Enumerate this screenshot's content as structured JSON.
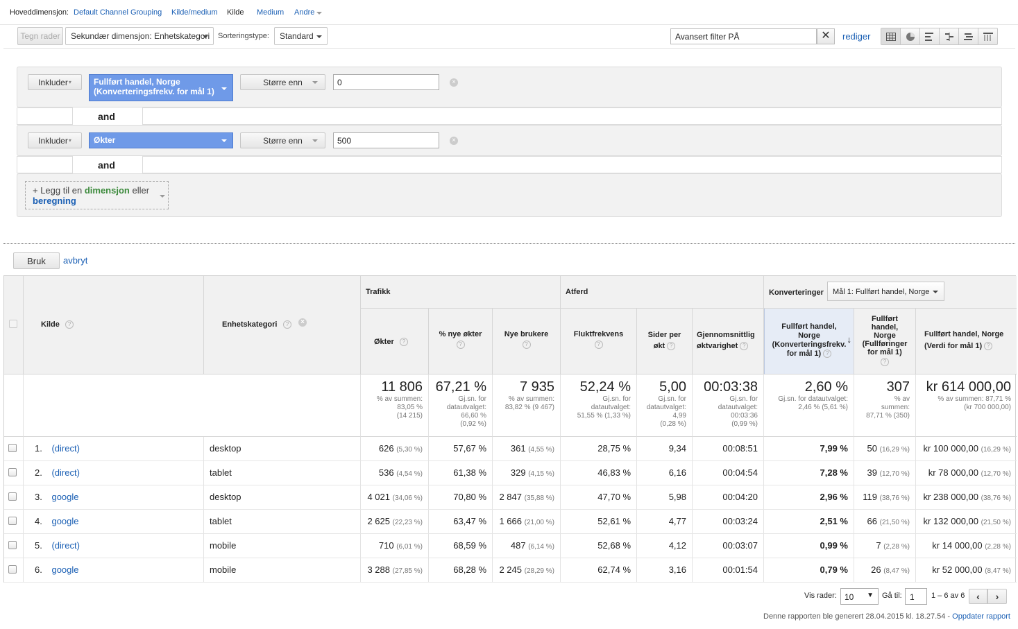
{
  "dimension_bar": {
    "label": "Hoveddimensjon:",
    "options": [
      "Default Channel Grouping",
      "Kilde/medium",
      "Kilde",
      "Medium",
      "Andre"
    ]
  },
  "toolbar": {
    "plot_rows": "Tegn rader",
    "secondary_dimension": "Sekundær dimensjon: Enhetskategori",
    "sort_label": "Sorteringstype:",
    "sort_value": "Standard",
    "filter_value": "Avansert filter PÅ",
    "edit_link": "rediger"
  },
  "filter": {
    "conditions": [
      {
        "mode": "Inkluder",
        "field_line1": "Fullført handel, Norge",
        "field_line2": "(Konverteringsfrekv. for mål 1)",
        "operator": "Større enn",
        "value": "0"
      },
      {
        "mode": "Inkluder",
        "field_line1": "Økter",
        "field_line2": "",
        "operator": "Større enn",
        "value": "500"
      }
    ],
    "and_label": "and",
    "add_prefix": "+ Legg til en",
    "add_dimension": "dimensjon",
    "add_or": "eller",
    "add_metric": "beregning",
    "apply": "Bruk",
    "cancel": "avbryt"
  },
  "table": {
    "group_headers": {
      "traffic": "Trafikk",
      "behavior": "Atferd",
      "conversions": "Konverteringer",
      "goal_select": "Mål 1: Fullført handel, Norge"
    },
    "col_source": "Kilde",
    "col_device": "Enhetskategori",
    "columns": {
      "sessions": "Økter",
      "new_sessions": "% nye økter",
      "new_users": "Nye brukere",
      "bounce": "Fluktfrekvens",
      "pages": [
        "Sider per",
        "økt"
      ],
      "duration": [
        "Gjennomsnittlig",
        "øktvarighet"
      ],
      "conv_rate": [
        "Fullført handel,",
        "Norge",
        "(Konverteringsfrekv.",
        "for mål 1)"
      ],
      "completions": [
        "Fullført",
        "handel,",
        "Norge",
        "(Fullføringer",
        "for mål 1)"
      ],
      "value": [
        "Fullført handel, Norge",
        "(Verdi for mål 1)"
      ]
    },
    "totals": {
      "sessions": {
        "big": "11 806",
        "sub": [
          "% av summen:",
          "83,05 %",
          "(14 215)"
        ]
      },
      "new_sessions": {
        "big": "67,21 %",
        "sub": [
          "Gj.sn. for",
          "datautvalget:",
          "66,60 %",
          "(0,92 %)"
        ]
      },
      "new_users": {
        "big": "7 935",
        "sub": [
          "% av summen:",
          "83,82 % (9 467)"
        ]
      },
      "bounce": {
        "big": "52,24 %",
        "sub": [
          "Gj.sn. for",
          "datautvalget:",
          "51,55 % (1,33 %)"
        ]
      },
      "pages": {
        "big": "5,00",
        "sub": [
          "Gj.sn. for",
          "datautvalget:",
          "4,99",
          "(0,28 %)"
        ]
      },
      "duration": {
        "big": "00:03:38",
        "sub": [
          "Gj.sn. for",
          "datautvalget:",
          "00:03:36",
          "(0,99 %)"
        ]
      },
      "conv_rate": {
        "big": "2,60 %",
        "sub": [
          "Gj.sn. for datautvalget:",
          "2,46 % (5,61 %)"
        ]
      },
      "completions": {
        "big": "307",
        "sub": [
          "% av",
          "summen:",
          "87,71 % (350)"
        ]
      },
      "value": {
        "big": "kr 614 000,00",
        "sub": [
          "% av summen: 87,71 %",
          "(kr 700 000,00)"
        ]
      }
    },
    "rows": [
      {
        "idx": "1.",
        "source": "(direct)",
        "device": "desktop",
        "sessions": "626",
        "sessions_pct": "(5,30 %)",
        "new_sessions": "57,67 %",
        "new_users": "361",
        "new_users_pct": "(4,55 %)",
        "bounce": "28,75 %",
        "pages": "9,34",
        "duration": "00:08:51",
        "conv_rate": "7,99 %",
        "completions": "50",
        "completions_pct": "(16,29 %)",
        "value": "kr 100 000,00",
        "value_pct": "(16,29 %)"
      },
      {
        "idx": "2.",
        "source": "(direct)",
        "device": "tablet",
        "sessions": "536",
        "sessions_pct": "(4,54 %)",
        "new_sessions": "61,38 %",
        "new_users": "329",
        "new_users_pct": "(4,15 %)",
        "bounce": "46,83 %",
        "pages": "6,16",
        "duration": "00:04:54",
        "conv_rate": "7,28 %",
        "completions": "39",
        "completions_pct": "(12,70 %)",
        "value": "kr 78 000,00",
        "value_pct": "(12,70 %)"
      },
      {
        "idx": "3.",
        "source": "google",
        "device": "desktop",
        "sessions": "4 021",
        "sessions_pct": "(34,06 %)",
        "new_sessions": "70,80 %",
        "new_users": "2 847",
        "new_users_pct": "(35,88 %)",
        "bounce": "47,70 %",
        "pages": "5,98",
        "duration": "00:04:20",
        "conv_rate": "2,96 %",
        "completions": "119",
        "completions_pct": "(38,76 %)",
        "value": "kr 238 000,00",
        "value_pct": "(38,76 %)"
      },
      {
        "idx": "4.",
        "source": "google",
        "device": "tablet",
        "sessions": "2 625",
        "sessions_pct": "(22,23 %)",
        "new_sessions": "63,47 %",
        "new_users": "1 666",
        "new_users_pct": "(21,00 %)",
        "bounce": "52,61 %",
        "pages": "4,77",
        "duration": "00:03:24",
        "conv_rate": "2,51 %",
        "completions": "66",
        "completions_pct": "(21,50 %)",
        "value": "kr 132 000,00",
        "value_pct": "(21,50 %)"
      },
      {
        "idx": "5.",
        "source": "(direct)",
        "device": "mobile",
        "sessions": "710",
        "sessions_pct": "(6,01 %)",
        "new_sessions": "68,59 %",
        "new_users": "487",
        "new_users_pct": "(6,14 %)",
        "bounce": "52,68 %",
        "pages": "4,12",
        "duration": "00:03:07",
        "conv_rate": "0,99 %",
        "completions": "7",
        "completions_pct": "(2,28 %)",
        "value": "kr 14 000,00",
        "value_pct": "(2,28 %)"
      },
      {
        "idx": "6.",
        "source": "google",
        "device": "mobile",
        "sessions": "3 288",
        "sessions_pct": "(27,85 %)",
        "new_sessions": "68,28 %",
        "new_users": "2 245",
        "new_users_pct": "(28,29 %)",
        "bounce": "62,74 %",
        "pages": "3,16",
        "duration": "00:01:54",
        "conv_rate": "0,79 %",
        "completions": "26",
        "completions_pct": "(8,47 %)",
        "value": "kr 52 000,00",
        "value_pct": "(8,47 %)"
      }
    ]
  },
  "pagination": {
    "show_rows_label": "Vis rader:",
    "rows_value": "10",
    "goto_label": "Gå til:",
    "goto_value": "1",
    "range": "1 – 6 av 6"
  },
  "footer": {
    "generated": "Denne rapporten ble generert 28.04.2015 kl. 18.27.54 -",
    "refresh": "Oppdater rapport"
  }
}
